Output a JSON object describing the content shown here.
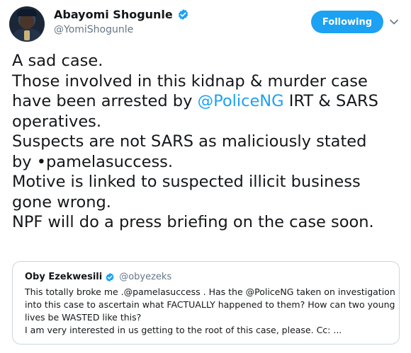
{
  "author": {
    "name": "Abayomi Shogunle",
    "handle": "@YomiShogunle",
    "verified": true
  },
  "follow_button": {
    "label": "Following",
    "color": "#1da1f2"
  },
  "tweet": {
    "lines": [
      "A sad case.",
      "Those involved in this kidnap & murder case",
      "have been arrested by ",
      "@PoliceNG",
      " IRT & SARS",
      "operatives.",
      "Suspects are not SARS as maliciously stated",
      "by •pamelasuccess.",
      "Motive is linked to suspected illicit business",
      "gone wrong.",
      "NPF will do a press briefing on the case soon."
    ]
  },
  "quoted_tweet": {
    "name": "Oby Ezekwesili",
    "handle": "@obyezeks",
    "verified": true,
    "lines": [
      "This totally broke me .@pamelasuccess . Has the @PoliceNG taken on investigation",
      "into this case to ascertain what FACTUALLY happened to them? How can two young",
      "lives be WASTED like this?",
      "I am very interested in us getting to the root of this case, please. Cc: ..."
    ]
  },
  "colors": {
    "link": "#1da1f2",
    "secondary_text": "#657786",
    "border": "#ccd6dd"
  }
}
